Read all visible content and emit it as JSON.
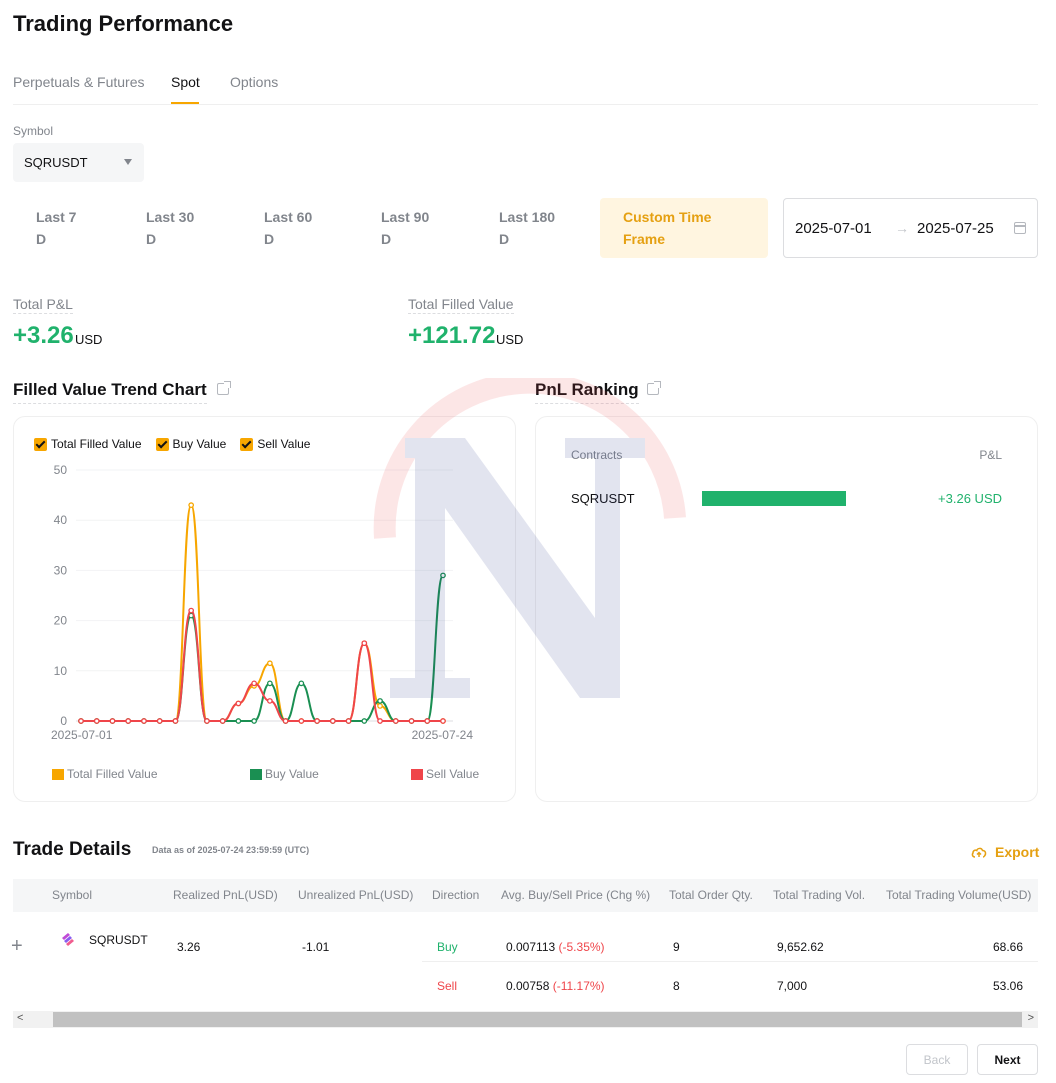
{
  "page": {
    "title": "Trading Performance"
  },
  "tabs": [
    {
      "label": "Perpetuals & Futures"
    },
    {
      "label": "Spot"
    },
    {
      "label": "Options"
    }
  ],
  "symbol": {
    "label": "Symbol",
    "value": "SQRUSDT"
  },
  "ranges": [
    {
      "line1": "Last 7",
      "line2": "D"
    },
    {
      "line1": "Last 30",
      "line2": "D"
    },
    {
      "line1": "Last 60",
      "line2": "D"
    },
    {
      "line1": "Last 90",
      "line2": "D"
    },
    {
      "line1": "Last 180",
      "line2": "D"
    },
    {
      "line1": "Custom Time",
      "line2": "Frame"
    }
  ],
  "date_range": {
    "start": "2025-07-01",
    "arrow": "→",
    "end": "2025-07-25"
  },
  "stats": {
    "pnl": {
      "label": "Total P&L",
      "value": "+3.26",
      "unit": "USD"
    },
    "filled": {
      "label": "Total Filled Value",
      "value": "+121.72",
      "unit": "USD"
    }
  },
  "trend_chart": {
    "title": "Filled Value Trend Chart",
    "toggles": [
      "Total Filled Value",
      "Buy Value",
      "Sell Value"
    ]
  },
  "chart_data": {
    "type": "line",
    "x": [
      "2025-07-01",
      "2025-07-02",
      "2025-07-03",
      "2025-07-04",
      "2025-07-05",
      "2025-07-06",
      "2025-07-07",
      "2025-07-08",
      "2025-07-09",
      "2025-07-10",
      "2025-07-11",
      "2025-07-12",
      "2025-07-13",
      "2025-07-14",
      "2025-07-15",
      "2025-07-16",
      "2025-07-17",
      "2025-07-18",
      "2025-07-19",
      "2025-07-20",
      "2025-07-21",
      "2025-07-22",
      "2025-07-23",
      "2025-07-24"
    ],
    "x_tick_labels": [
      "2025-07-01",
      "2025-07-24"
    ],
    "ylim": [
      0,
      50
    ],
    "y_ticks": [
      0,
      10,
      20,
      30,
      40,
      50
    ],
    "grid": true,
    "legend": "bottom",
    "series": [
      {
        "name": "Total Filled Value",
        "color": "#f7a600",
        "values": [
          0,
          0,
          0,
          0,
          0,
          0,
          0,
          43,
          0,
          0,
          3.5,
          7,
          11.5,
          0,
          0,
          0,
          0,
          0,
          15.5,
          3,
          0,
          0,
          0,
          0
        ]
      },
      {
        "name": "Buy Value",
        "color": "#1a8f52",
        "values": [
          0,
          0,
          0,
          0,
          0,
          0,
          0,
          21,
          0,
          0,
          0,
          0,
          7.5,
          0,
          7.5,
          0,
          0,
          0,
          0,
          4,
          0,
          0,
          0,
          29
        ]
      },
      {
        "name": "Sell Value",
        "color": "#ef454a",
        "values": [
          0,
          0,
          0,
          0,
          0,
          0,
          0,
          22,
          0,
          0,
          3.5,
          7.5,
          4,
          0,
          0,
          0,
          0,
          0,
          15.5,
          0,
          0,
          0,
          0,
          0
        ]
      }
    ]
  },
  "ranking": {
    "title": "PnL Ranking",
    "col_contracts": "Contracts",
    "col_pnl": "P&L",
    "row": {
      "symbol": "SQRUSDT",
      "value": "+3.26 USD",
      "share": 1.0
    }
  },
  "trade_details": {
    "title": "Trade Details",
    "subtitle": "Data as of 2025-07-24 23:59:59 (UTC)",
    "export_label": "Export",
    "columns": [
      "Symbol",
      "Realized PnL(USD)",
      "Unrealized PnL(USD)",
      "Direction",
      "Avg. Buy/Sell Price (Chg %)",
      "Total Order Qty.",
      "Total Trading Vol.",
      "Total Trading Volume(USD)"
    ],
    "symbol": "SQRUSDT",
    "realized": "3.26",
    "unrealized": "-1.01",
    "rows": [
      {
        "direction": "Buy",
        "price": "0.007113",
        "chg": "(-5.35%)",
        "qty": "9",
        "vol": "9,652.62",
        "vol_usd": "68.66"
      },
      {
        "direction": "Sell",
        "price": "0.00758",
        "chg": "(-11.17%)",
        "qty": "8",
        "vol": "7,000",
        "vol_usd": "53.06"
      }
    ],
    "expand_glyph": "+"
  },
  "scrollbar": {
    "left_arrow": "<",
    "right_arrow": ">"
  },
  "pager": {
    "back": "Back",
    "next": "Next"
  }
}
